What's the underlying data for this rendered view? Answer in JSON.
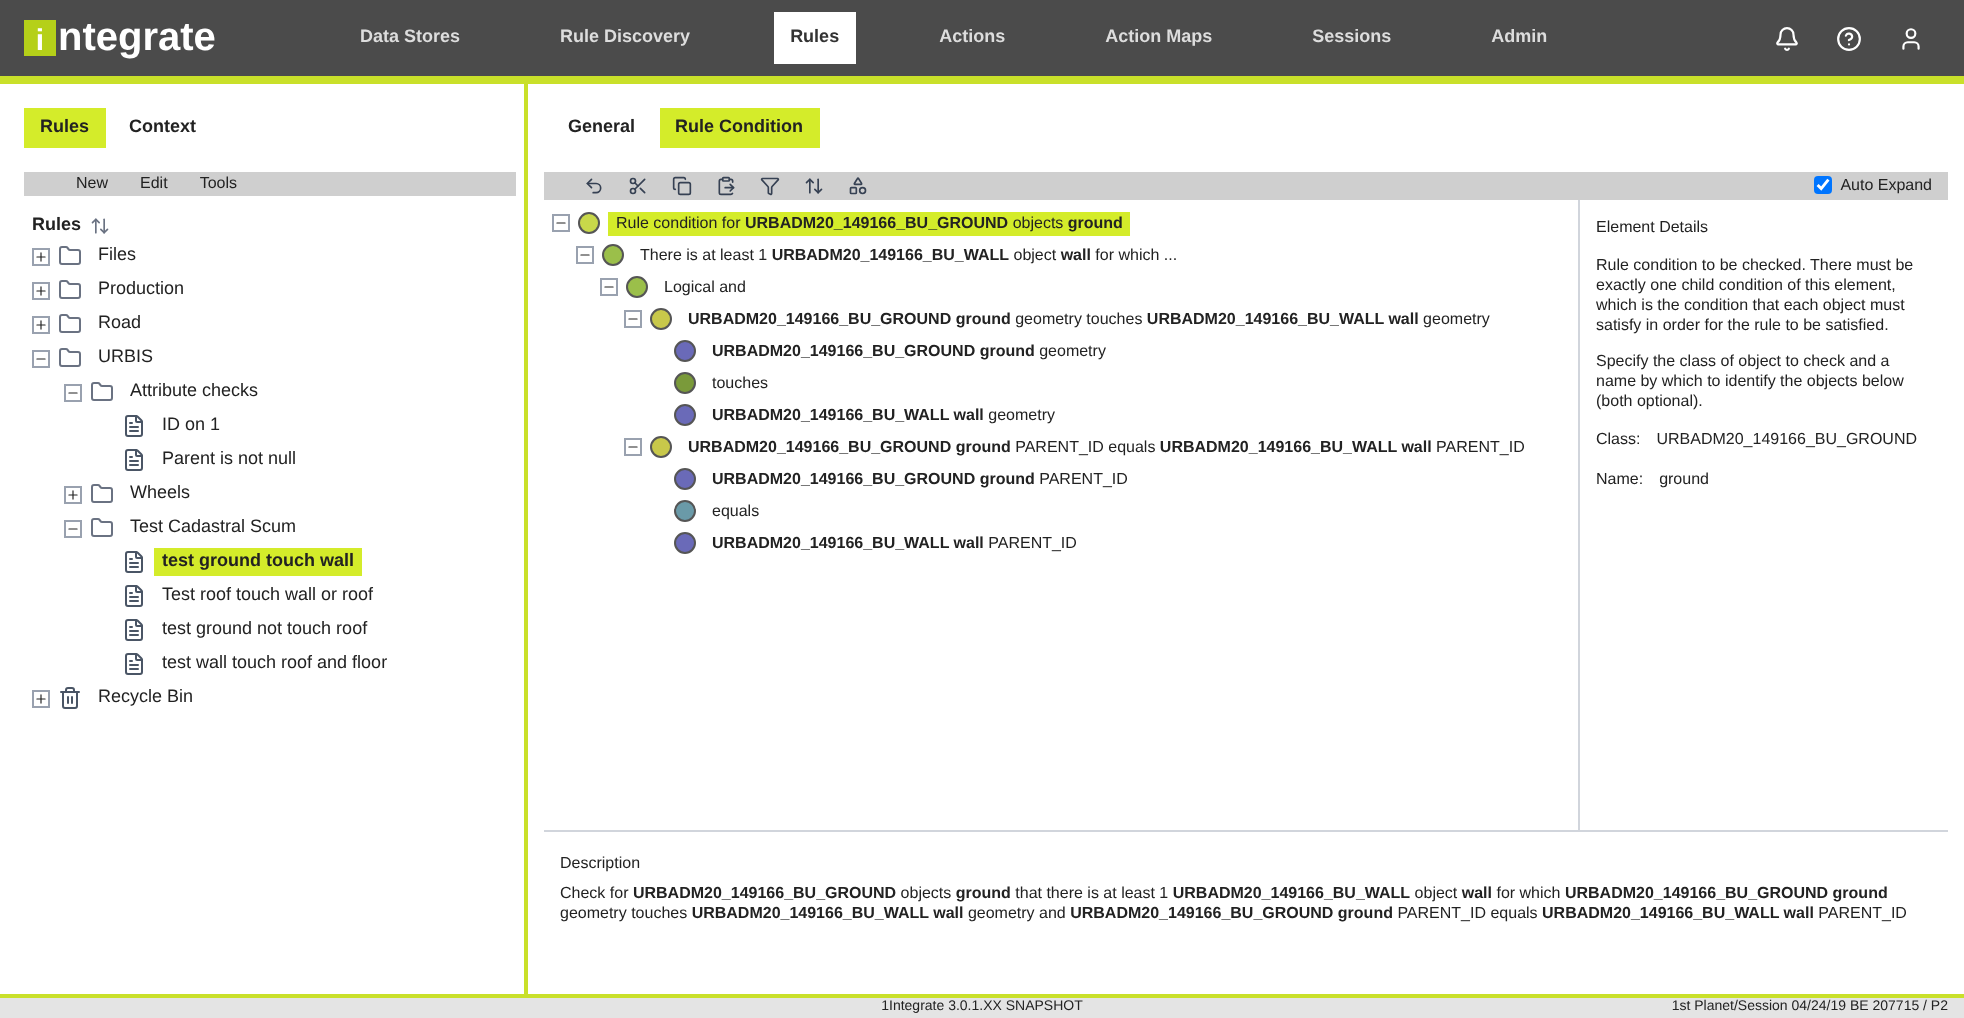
{
  "app": {
    "logo_letter": "i",
    "logo_text": "ntegrate"
  },
  "nav": [
    {
      "label": "Data Stores",
      "selected": false
    },
    {
      "label": "Rule Discovery",
      "selected": false
    },
    {
      "label": "Rules",
      "selected": true
    },
    {
      "label": "Actions",
      "selected": false
    },
    {
      "label": "Action Maps",
      "selected": false
    },
    {
      "label": "Sessions",
      "selected": false
    },
    {
      "label": "Admin",
      "selected": false
    }
  ],
  "left_tabs": [
    {
      "label": "Rules",
      "selected": true
    },
    {
      "label": "Context",
      "selected": false
    }
  ],
  "menu": [
    "New",
    "Edit",
    "Tools"
  ],
  "rules_tree": {
    "title": "Rules",
    "items": [
      {
        "kind": "folder",
        "label": "Files",
        "expanded": false
      },
      {
        "kind": "folder",
        "label": "Production",
        "expanded": false
      },
      {
        "kind": "folder",
        "label": "Road",
        "expanded": false
      },
      {
        "kind": "folder",
        "label": "URBIS",
        "expanded": true,
        "children": [
          {
            "kind": "folder",
            "label": "Attribute checks",
            "expanded": true,
            "children": [
              {
                "kind": "rule",
                "label": "ID on 1",
                "selected": false
              },
              {
                "kind": "rule",
                "label": "Parent is not null",
                "selected": false
              }
            ]
          },
          {
            "kind": "folder",
            "label": "Wheels",
            "expanded": false
          },
          {
            "kind": "folder",
            "label": "Test Cadastral Scum",
            "expanded": true,
            "children": [
              {
                "kind": "rule",
                "label": "test ground touch wall",
                "selected": true
              },
              {
                "kind": "rule",
                "label": "Test roof touch wall or roof",
                "selected": false
              },
              {
                "kind": "rule",
                "label": "test ground not touch roof",
                "selected": false
              },
              {
                "kind": "rule",
                "label": "test wall touch roof and floor",
                "selected": false
              }
            ]
          }
        ]
      },
      {
        "kind": "bin",
        "label": "Recycle Bin",
        "expanded": false
      }
    ]
  },
  "right_tabs": [
    {
      "label": "General",
      "selected": false
    },
    {
      "label": "Rule Condition",
      "selected": true
    }
  ],
  "auto_expand": {
    "label": "Auto Expand",
    "checked": true
  },
  "condition_tree": [
    {
      "kind": "root",
      "text": "Rule condition for **URBADM20_149166_BU_GROUND** objects **ground**",
      "selected": true,
      "children": [
        {
          "kind": "exists",
          "text": "There is at least 1 **URBADM20_149166_BU_WALL** object **wall** for which ...",
          "selected": false,
          "children": [
            {
              "kind": "logic",
              "text": "Logical and",
              "selected": false,
              "children": [
                {
                  "kind": "test",
                  "text": "**URBADM20_149166_BU_GROUND ground** geometry touches **URBADM20_149166_BU_WALL wall** geometry",
                  "selected": false,
                  "children": [
                    {
                      "kind": "value",
                      "text": "**URBADM20_149166_BU_GROUND ground** geometry",
                      "selected": false
                    },
                    {
                      "kind": "operator",
                      "text": "touches",
                      "selected": false
                    },
                    {
                      "kind": "value",
                      "text": "**URBADM20_149166_BU_WALL wall** geometry",
                      "selected": false
                    }
                  ]
                },
                {
                  "kind": "test",
                  "text": "**URBADM20_149166_BU_GROUND ground** PARENT_ID equals **URBADM20_149166_BU_WALL wall** PARENT_ID",
                  "selected": false,
                  "children": [
                    {
                      "kind": "value",
                      "text": "**URBADM20_149166_BU_GROUND ground** PARENT_ID",
                      "selected": false
                    },
                    {
                      "kind": "comparison",
                      "text": "equals",
                      "selected": false
                    },
                    {
                      "kind": "value",
                      "text": "**URBADM20_149166_BU_WALL wall** PARENT_ID",
                      "selected": false
                    }
                  ]
                }
              ]
            }
          ]
        }
      ]
    }
  ],
  "element_details": {
    "title": "Element Details",
    "paragraphs": [
      "Rule condition to be checked. There must be exactly one child condition of this element, which is the condition that each object must satisfy in order for the rule to be satisfied.",
      "Specify the class of object to check and a name by which to identify the objects below (both optional)."
    ],
    "fields": [
      {
        "label": "Class:",
        "value": "URBADM20_149166_BU_GROUND"
      },
      {
        "label": "Name:",
        "value": "ground"
      }
    ]
  },
  "description": {
    "label": "Description",
    "text": "Check for **URBADM20_149166_BU_GROUND** objects **ground** that there is at least 1 **URBADM20_149166_BU_WALL** object **wall** for which **URBADM20_149166_BU_GROUND ground** geometry touches **URBADM20_149166_BU_WALL wall** geometry and **URBADM20_149166_BU_GROUND ground** PARENT_ID equals **URBADM20_149166_BU_WALL wall** PARENT_ID"
  },
  "status_bar": {
    "version": "1Integrate 3.0.1.XX SNAPSHOT",
    "user": "1st Planet/Session 04/24/19 BE 207715 / P2"
  }
}
